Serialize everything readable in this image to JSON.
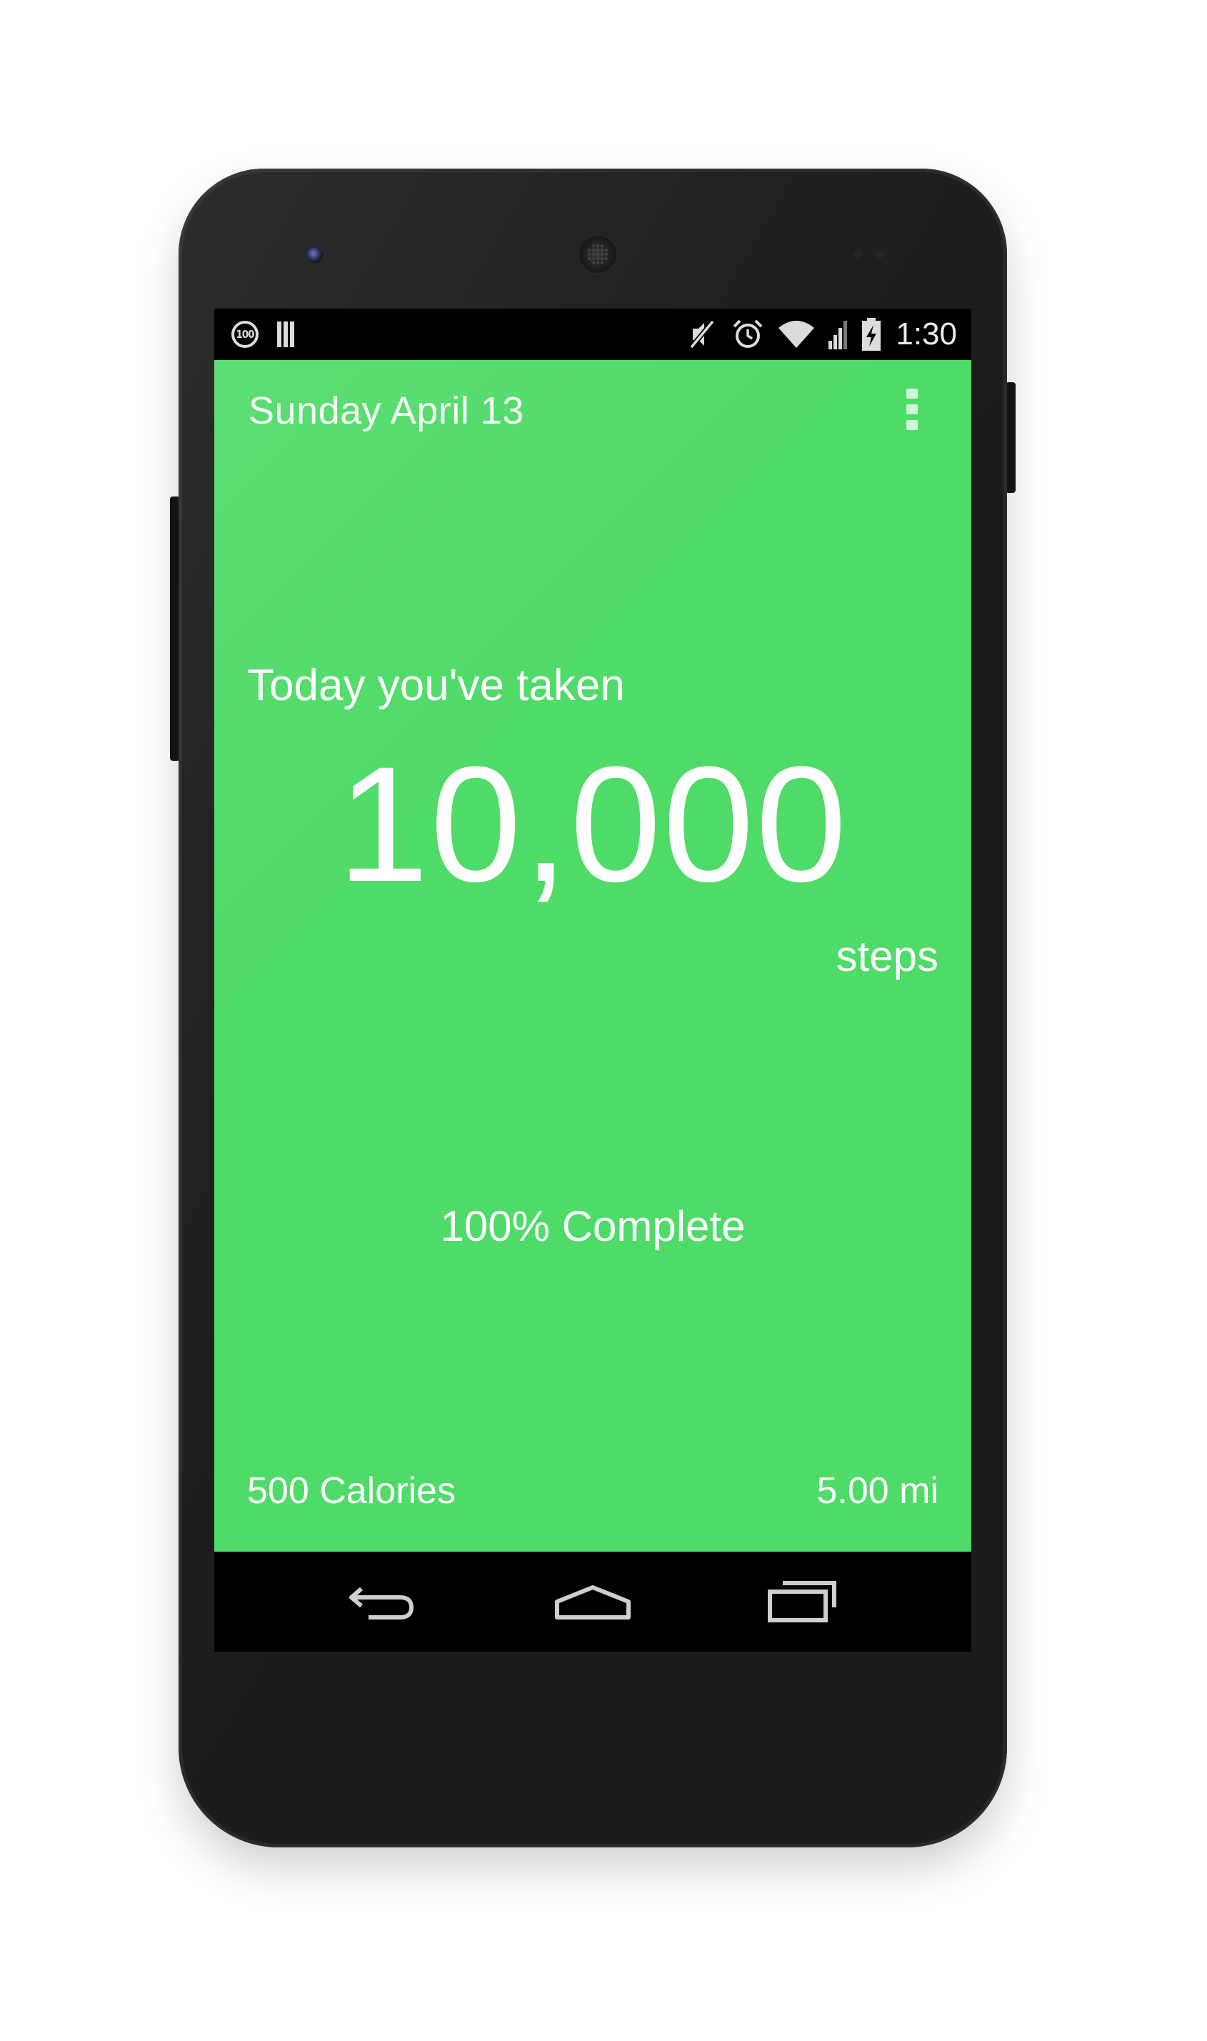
{
  "status_bar": {
    "badge_text": "100",
    "clock": "1:30",
    "icons": [
      "circle-100-icon",
      "barcode-icon",
      "mute-icon",
      "alarm-icon",
      "wifi-icon",
      "cell-signal-icon",
      "battery-charging-icon"
    ]
  },
  "app": {
    "date": "Sunday April 13",
    "intro": "Today you've taken",
    "steps": "10,000",
    "steps_unit": "steps",
    "progress_text": "100% Complete",
    "progress_percent": 100,
    "calories": "500 Calories",
    "distance": "5.00 mi",
    "background_color": "#4fdb68"
  },
  "nav_bar": {
    "buttons": [
      "back-icon",
      "home-icon",
      "recent-apps-icon"
    ]
  }
}
